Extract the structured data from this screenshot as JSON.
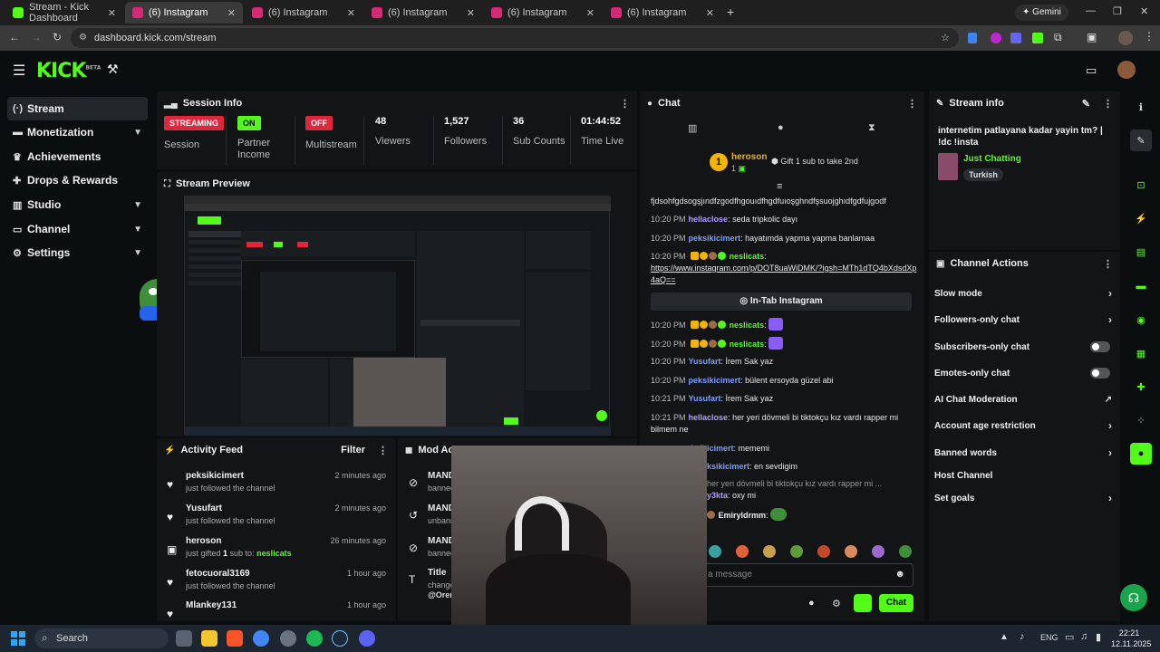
{
  "browser": {
    "tabs": [
      {
        "label": "Stream - Kick Dashboard",
        "active": false,
        "color": "#53fc18"
      },
      {
        "label": "(6) Instagram",
        "active": true,
        "color": "#d62976"
      },
      {
        "label": "(6) Instagram",
        "active": false,
        "color": "#d62976"
      },
      {
        "label": "(6) Instagram",
        "active": false,
        "color": "#d62976"
      },
      {
        "label": "(6) Instagram",
        "active": false,
        "color": "#d62976"
      },
      {
        "label": "(6) Instagram",
        "active": false,
        "color": "#d62976"
      }
    ],
    "new_tab": "+",
    "gemini": "Gemini",
    "url": "dashboard.kick.com/stream"
  },
  "site": {
    "logo": "KICK",
    "logo_sup": "BETA",
    "accent": "#53fc18"
  },
  "sidebar": {
    "items": [
      {
        "label": "Stream",
        "icon": "broadcast-icon",
        "glyph": "(·)",
        "active": true,
        "chevron": false
      },
      {
        "label": "Monetization",
        "icon": "money-icon",
        "glyph": "▬",
        "active": false,
        "chevron": true
      },
      {
        "label": "Achievements",
        "icon": "trophy-icon",
        "glyph": "♛",
        "active": false,
        "chevron": false
      },
      {
        "label": "Drops & Rewards",
        "icon": "gift-icon",
        "glyph": "✚",
        "active": false,
        "chevron": false
      },
      {
        "label": "Studio",
        "icon": "studio-icon",
        "glyph": "▥",
        "active": false,
        "chevron": true
      },
      {
        "label": "Channel",
        "icon": "tv-icon",
        "glyph": "▭",
        "active": false,
        "chevron": true
      },
      {
        "label": "Settings",
        "icon": "gear-icon",
        "glyph": "⚙",
        "active": false,
        "chevron": true
      }
    ]
  },
  "session": {
    "title": "Session Info",
    "streaming_badge": "STREAMING",
    "session_label": "Session",
    "partner_badge": "ON",
    "partner_label": "Partner Income",
    "multistream_badge": "OFF",
    "multistream_label": "Multistream",
    "viewers": "48",
    "viewers_label": "Viewers",
    "followers": "1,527",
    "followers_label": "Followers",
    "subs": "36",
    "subs_label": "Sub Counts",
    "time": "01:44:52",
    "time_label": "Time Live"
  },
  "preview": {
    "title": "Stream Preview"
  },
  "activity": {
    "title": "Activity Feed",
    "filter": "Filter",
    "items": [
      {
        "name": "peksikicimert",
        "sub": "just followed the channel",
        "time": "2 minutes ago",
        "icon": "heart-icon",
        "glyph": "♥"
      },
      {
        "name": "Yusufart",
        "sub": "just followed the channel",
        "time": "2 minutes ago",
        "icon": "heart-icon",
        "glyph": "♥"
      },
      {
        "name": "heroson",
        "sub_pre": "just gifted ",
        "sub_count": "1",
        "sub_mid": " sub to: ",
        "sub_target": "neslicats",
        "time": "26 minutes ago",
        "icon": "gift-icon",
        "glyph": "▣"
      },
      {
        "name": "fetocuoral3169",
        "sub": "just followed the channel",
        "time": "1 hour ago",
        "icon": "heart-icon",
        "glyph": "♥"
      },
      {
        "name": "Mlankey131",
        "sub": "",
        "time": "1 hour ago",
        "icon": "heart-icon",
        "glyph": "♥"
      }
    ]
  },
  "mod": {
    "title": "Mod Actions",
    "items": [
      {
        "t1": "MAND",
        "t2": "bannec",
        "icon": "ban-icon",
        "glyph": "⊘"
      },
      {
        "t1": "MAND",
        "t2": "unbanr",
        "icon": "undo-icon",
        "glyph": "↺"
      },
      {
        "t1": "MAND",
        "t2": "bannec",
        "icon": "ban-icon",
        "glyph": "⊘"
      },
      {
        "t1": "Title",
        "t2": "change",
        "t3": "@Orene",
        "icon": "title-icon",
        "glyph": "T"
      }
    ]
  },
  "chat": {
    "title": "Chat",
    "pinned_user": "heroson",
    "pinned_count": "1",
    "gift_text": "Gift 1 sub to take 2nd",
    "top_line": "fjdsohfgdsogşjındfzgodfhgouıdfhgdfuıoşghndfşsuojghıdfgdfujgodf",
    "messages": [
      {
        "time": "10:20 PM",
        "user": "hellaclose",
        "ucolor": "u-purple",
        "text": ": seda tripkolic dayı"
      },
      {
        "time": "10:20 PM",
        "user": "peksikicimert",
        "ucolor": "u-blue",
        "text": ": hayatımda yapma yapma banlamaa"
      },
      {
        "time": "10:20 PM",
        "user": "neslicats",
        "ucolor": "u-green",
        "text": ":",
        "link": "https://www.instagram.com/p/DOT8uaWiDMK/?igsh=MTh1dTQ4bXdsdXp4aQ=="
      },
      {
        "time": "10:20 PM",
        "user": "neslicats",
        "ucolor": "u-green",
        "text": ":"
      },
      {
        "time": "10:20 PM",
        "user": "neslicats",
        "ucolor": "u-green",
        "text": ":"
      },
      {
        "time": "10:20 PM",
        "user": "Yusufart",
        "ucolor": "u-blue",
        "text": ": İrem Sak yaz"
      },
      {
        "time": "10:20 PM",
        "user": "peksikicimert",
        "ucolor": "u-blue",
        "text": ": bülent ersoyda güzel abi"
      },
      {
        "time": "10:21 PM",
        "user": "Yusufart",
        "ucolor": "u-blue",
        "text": ": İrem Sak yaz"
      },
      {
        "time": "10:21 PM",
        "user": "hellaclose",
        "ucolor": "u-purple",
        "text": ": her yeri dövmeli bi tiktokçu kız vardı rapper mi bilmem ne"
      },
      {
        "time": "",
        "user": "peksikicimert",
        "ucolor": "u-blue",
        "text": ": mememi"
      },
      {
        "time": "",
        "user": "ksikicimert",
        "ucolor": "u-blue",
        "text": ": en sevdigim"
      },
      {
        "time": "",
        "user": "",
        "ucolor": "u-blue",
        "text": "her yeri dövmeli bi tiktokçu kız vardı rapper mi ..."
      },
      {
        "time": "",
        "user": "y3kta",
        "ucolor": "u-purple",
        "text": ": oxy mi"
      },
      {
        "time": "",
        "user": "Emiryldrmm",
        "ucolor": "u-green",
        "text": ":"
      }
    ],
    "intab_button": "In-Tab Instagram",
    "placeholder": "a message",
    "send": "Chat"
  },
  "stream_info": {
    "title": "Stream info",
    "stream_title": "internetim patlayana kadar yayin tm? | !dc !insta",
    "category": "Just Chatting",
    "tag": "Turkish"
  },
  "channel_actions": {
    "title": "Channel Actions",
    "rows": [
      {
        "label": "Slow mode",
        "control": "›"
      },
      {
        "label": "Followers-only chat",
        "control": "›"
      },
      {
        "label": "Subscribers-only chat",
        "control": "toggle"
      },
      {
        "label": "Emotes-only chat",
        "control": "toggle"
      },
      {
        "label": "AI Chat Moderation",
        "control": "↗"
      },
      {
        "label": "Account age restriction",
        "control": "›"
      },
      {
        "label": "Banned words",
        "control": "›"
      },
      {
        "label": "Host Channel",
        "control": ""
      },
      {
        "label": "Set goals",
        "control": "›"
      }
    ]
  },
  "taskbar": {
    "search": "Search",
    "lang": "ENG",
    "time": "22:21",
    "date": "12.11.2025"
  }
}
